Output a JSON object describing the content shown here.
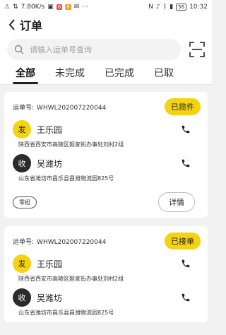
{
  "status_bar": {
    "speed": "7.80K/s",
    "battery": "56",
    "time": "10:32",
    "badge1": "6",
    "badge2": "6"
  },
  "header": {
    "title": "订单"
  },
  "search": {
    "placeholder": "请输入运单号查询"
  },
  "tabs": [
    {
      "label": "全部",
      "active": true
    },
    {
      "label": "未完成"
    },
    {
      "label": "已完成"
    },
    {
      "label": "已取"
    }
  ],
  "orders": [
    {
      "waybill_label": "运单号:",
      "waybill_no": "WHWL202007220044",
      "status": "已揽件",
      "sender": {
        "tag": "发",
        "name": "王乐园",
        "address": "陕西省西安市高陵区姬家街办事处刘村2组"
      },
      "receiver": {
        "tag": "收",
        "name": "吴潍坊",
        "address": "山东省潍坊市昌乐县昌潍物流园825号"
      },
      "tag": "零担",
      "detail_label": "详情"
    },
    {
      "waybill_label": "运单号:",
      "waybill_no": "WHWL202007220044",
      "status": "已接单",
      "sender": {
        "tag": "发",
        "name": "王乐园",
        "address": "陕西省西安市高陵区姬家街办事处刘村2组"
      },
      "receiver": {
        "tag": "收",
        "name": "吴潍坊",
        "address": "山东省潍坊市昌乐县昌潍物流园825号"
      }
    }
  ],
  "colors": {
    "accent": "#f5d313",
    "dark": "#2b2b2b"
  }
}
